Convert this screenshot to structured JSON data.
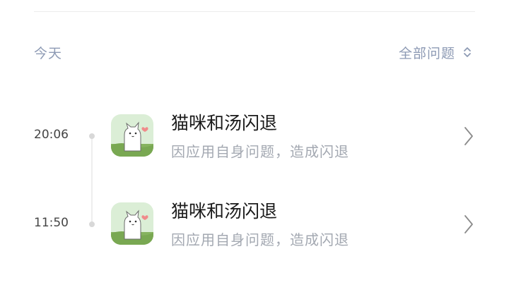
{
  "header": {
    "date_label": "今天",
    "filter_label": "全部问题",
    "filter_icon": "chevron-updown-icon"
  },
  "records": [
    {
      "time": "20:06",
      "app_name": "猫咪和汤闪退",
      "description": "因应用自身问题，造成闪退",
      "icon": "cat-app-icon"
    },
    {
      "time": "11:50",
      "app_name": "猫咪和汤闪退",
      "description": "因应用自身问题，造成闪退",
      "icon": "cat-app-icon"
    }
  ],
  "colors": {
    "accent_text": "#8d9ab4",
    "secondary_text": "#a3a8b1",
    "primary_text": "#1a1a1a",
    "app_icon_sky": "#d9efd9",
    "app_icon_grass": "#7fb05a"
  }
}
